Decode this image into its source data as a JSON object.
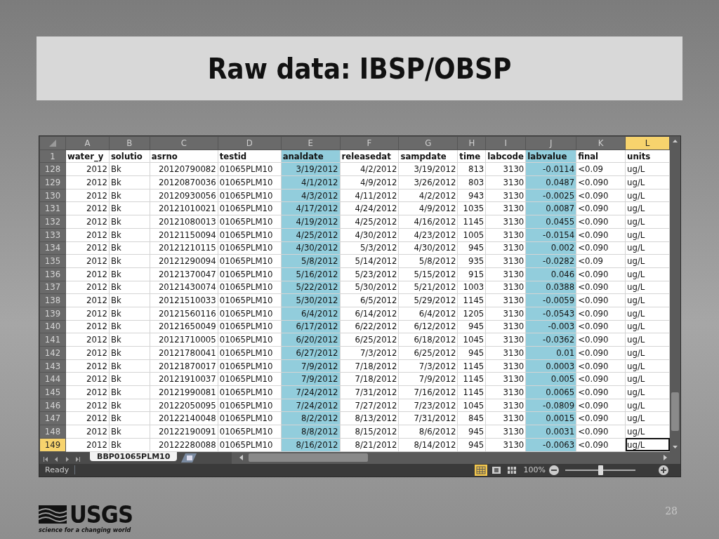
{
  "slide": {
    "title": "Raw data: IBSP/OBSP",
    "page_number": "28",
    "logo": {
      "wordmark": "USGS",
      "tagline": "science for a changing world"
    }
  },
  "sheet": {
    "header_row_number": "1",
    "columns": [
      {
        "letter": "A",
        "header": "water_y",
        "kind": "numeric",
        "highlighted": false,
        "selected": false
      },
      {
        "letter": "B",
        "header": "solutio",
        "kind": "text",
        "highlighted": false,
        "selected": false
      },
      {
        "letter": "C",
        "header": "asrno",
        "kind": "numeric",
        "highlighted": false,
        "selected": false
      },
      {
        "letter": "D",
        "header": "testid",
        "kind": "text",
        "highlighted": false,
        "selected": false
      },
      {
        "letter": "E",
        "header": "analdate",
        "kind": "numeric",
        "highlighted": true,
        "selected": false
      },
      {
        "letter": "F",
        "header": "releasedat",
        "kind": "numeric",
        "highlighted": false,
        "selected": false
      },
      {
        "letter": "G",
        "header": "sampdate",
        "kind": "numeric",
        "highlighted": false,
        "selected": false
      },
      {
        "letter": "H",
        "header": "time",
        "kind": "numeric",
        "highlighted": false,
        "selected": false
      },
      {
        "letter": "I",
        "header": "labcode",
        "kind": "numeric",
        "highlighted": false,
        "selected": false
      },
      {
        "letter": "J",
        "header": "labvalue",
        "kind": "numeric",
        "highlighted": true,
        "selected": false
      },
      {
        "letter": "K",
        "header": "final",
        "kind": "text",
        "highlighted": false,
        "selected": false
      },
      {
        "letter": "L",
        "header": "units",
        "kind": "text",
        "highlighted": false,
        "selected": true
      }
    ],
    "rows": [
      {
        "number": "128",
        "selected": false,
        "cells": [
          "2012",
          "Bk",
          "20120790082",
          "01065PLM10",
          "3/19/2012",
          "4/2/2012",
          "3/19/2012",
          "813",
          "3130",
          "-0.0114",
          "<0.09",
          "ug/L"
        ]
      },
      {
        "number": "129",
        "selected": false,
        "cells": [
          "2012",
          "Bk",
          "20120870036",
          "01065PLM10",
          "4/1/2012",
          "4/9/2012",
          "3/26/2012",
          "803",
          "3130",
          "0.0487",
          "<0.090",
          "ug/L"
        ]
      },
      {
        "number": "130",
        "selected": false,
        "cells": [
          "2012",
          "Bk",
          "20120930056",
          "01065PLM10",
          "4/3/2012",
          "4/11/2012",
          "4/2/2012",
          "943",
          "3130",
          "-0.0025",
          "<0.090",
          "ug/L"
        ]
      },
      {
        "number": "131",
        "selected": false,
        "cells": [
          "2012",
          "Bk",
          "20121010021",
          "01065PLM10",
          "4/17/2012",
          "4/24/2012",
          "4/9/2012",
          "1035",
          "3130",
          "0.0087",
          "<0.090",
          "ug/L"
        ]
      },
      {
        "number": "132",
        "selected": false,
        "cells": [
          "2012",
          "Bk",
          "20121080013",
          "01065PLM10",
          "4/19/2012",
          "4/25/2012",
          "4/16/2012",
          "1145",
          "3130",
          "0.0455",
          "<0.090",
          "ug/L"
        ]
      },
      {
        "number": "133",
        "selected": false,
        "cells": [
          "2012",
          "Bk",
          "20121150094",
          "01065PLM10",
          "4/25/2012",
          "4/30/2012",
          "4/23/2012",
          "1005",
          "3130",
          "-0.0154",
          "<0.090",
          "ug/L"
        ]
      },
      {
        "number": "134",
        "selected": false,
        "cells": [
          "2012",
          "Bk",
          "20121210115",
          "01065PLM10",
          "4/30/2012",
          "5/3/2012",
          "4/30/2012",
          "945",
          "3130",
          "0.002",
          "<0.090",
          "ug/L"
        ]
      },
      {
        "number": "135",
        "selected": false,
        "cells": [
          "2012",
          "Bk",
          "20121290094",
          "01065PLM10",
          "5/8/2012",
          "5/14/2012",
          "5/8/2012",
          "935",
          "3130",
          "-0.0282",
          "<0.09",
          "ug/L"
        ]
      },
      {
        "number": "136",
        "selected": false,
        "cells": [
          "2012",
          "Bk",
          "20121370047",
          "01065PLM10",
          "5/16/2012",
          "5/23/2012",
          "5/15/2012",
          "915",
          "3130",
          "0.046",
          "<0.090",
          "ug/L"
        ]
      },
      {
        "number": "137",
        "selected": false,
        "cells": [
          "2012",
          "Bk",
          "20121430074",
          "01065PLM10",
          "5/22/2012",
          "5/30/2012",
          "5/21/2012",
          "1003",
          "3130",
          "0.0388",
          "<0.090",
          "ug/L"
        ]
      },
      {
        "number": "138",
        "selected": false,
        "cells": [
          "2012",
          "Bk",
          "20121510033",
          "01065PLM10",
          "5/30/2012",
          "6/5/2012",
          "5/29/2012",
          "1145",
          "3130",
          "-0.0059",
          "<0.090",
          "ug/L"
        ]
      },
      {
        "number": "139",
        "selected": false,
        "cells": [
          "2012",
          "Bk",
          "20121560116",
          "01065PLM10",
          "6/4/2012",
          "6/14/2012",
          "6/4/2012",
          "1205",
          "3130",
          "-0.0543",
          "<0.090",
          "ug/L"
        ]
      },
      {
        "number": "140",
        "selected": false,
        "cells": [
          "2012",
          "Bk",
          "20121650049",
          "01065PLM10",
          "6/17/2012",
          "6/22/2012",
          "6/12/2012",
          "945",
          "3130",
          "-0.003",
          "<0.090",
          "ug/L"
        ]
      },
      {
        "number": "141",
        "selected": false,
        "cells": [
          "2012",
          "Bk",
          "20121710005",
          "01065PLM10",
          "6/20/2012",
          "6/25/2012",
          "6/18/2012",
          "1045",
          "3130",
          "-0.0362",
          "<0.090",
          "ug/L"
        ]
      },
      {
        "number": "142",
        "selected": false,
        "cells": [
          "2012",
          "Bk",
          "20121780041",
          "01065PLM10",
          "6/27/2012",
          "7/3/2012",
          "6/25/2012",
          "945",
          "3130",
          "0.01",
          "<0.090",
          "ug/L"
        ]
      },
      {
        "number": "143",
        "selected": false,
        "cells": [
          "2012",
          "Bk",
          "20121870017",
          "01065PLM10",
          "7/9/2012",
          "7/18/2012",
          "7/3/2012",
          "1145",
          "3130",
          "0.0003",
          "<0.090",
          "ug/L"
        ]
      },
      {
        "number": "144",
        "selected": false,
        "cells": [
          "2012",
          "Bk",
          "20121910037",
          "01065PLM10",
          "7/9/2012",
          "7/18/2012",
          "7/9/2012",
          "1145",
          "3130",
          "0.005",
          "<0.090",
          "ug/L"
        ]
      },
      {
        "number": "145",
        "selected": false,
        "cells": [
          "2012",
          "Bk",
          "20121990081",
          "01065PLM10",
          "7/24/2012",
          "7/31/2012",
          "7/16/2012",
          "1145",
          "3130",
          "0.0065",
          "<0.090",
          "ug/L"
        ]
      },
      {
        "number": "146",
        "selected": false,
        "cells": [
          "2012",
          "Bk",
          "20122050095",
          "01065PLM10",
          "7/24/2012",
          "7/27/2012",
          "7/23/2012",
          "1045",
          "3130",
          "-0.0809",
          "<0.090",
          "ug/L"
        ]
      },
      {
        "number": "147",
        "selected": false,
        "cells": [
          "2012",
          "Bk",
          "20122140048",
          "01065PLM10",
          "8/2/2012",
          "8/13/2012",
          "7/31/2012",
          "845",
          "3130",
          "0.0015",
          "<0.090",
          "ug/L"
        ]
      },
      {
        "number": "148",
        "selected": false,
        "cells": [
          "2012",
          "Bk",
          "20122190091",
          "01065PLM10",
          "8/8/2012",
          "8/15/2012",
          "8/6/2012",
          "945",
          "3130",
          "0.0031",
          "<0.090",
          "ug/L"
        ]
      },
      {
        "number": "149",
        "selected": true,
        "cells": [
          "2012",
          "Bk",
          "20122280088",
          "01065PLM10",
          "8/16/2012",
          "8/21/2012",
          "8/14/2012",
          "945",
          "3130",
          "-0.0063",
          "<0.090",
          "ug/L"
        ]
      }
    ],
    "sheet_tabs": [
      {
        "label": "BBP01065PLM10",
        "selected": true
      }
    ]
  },
  "status_bar": {
    "text": "Ready",
    "views": [
      {
        "kind": "normal",
        "selected": true
      },
      {
        "kind": "page_layout",
        "selected": false
      },
      {
        "kind": "page_break",
        "selected": false
      }
    ],
    "zoom": "100%",
    "zoom_slider": {
      "level": 0.5
    }
  }
}
